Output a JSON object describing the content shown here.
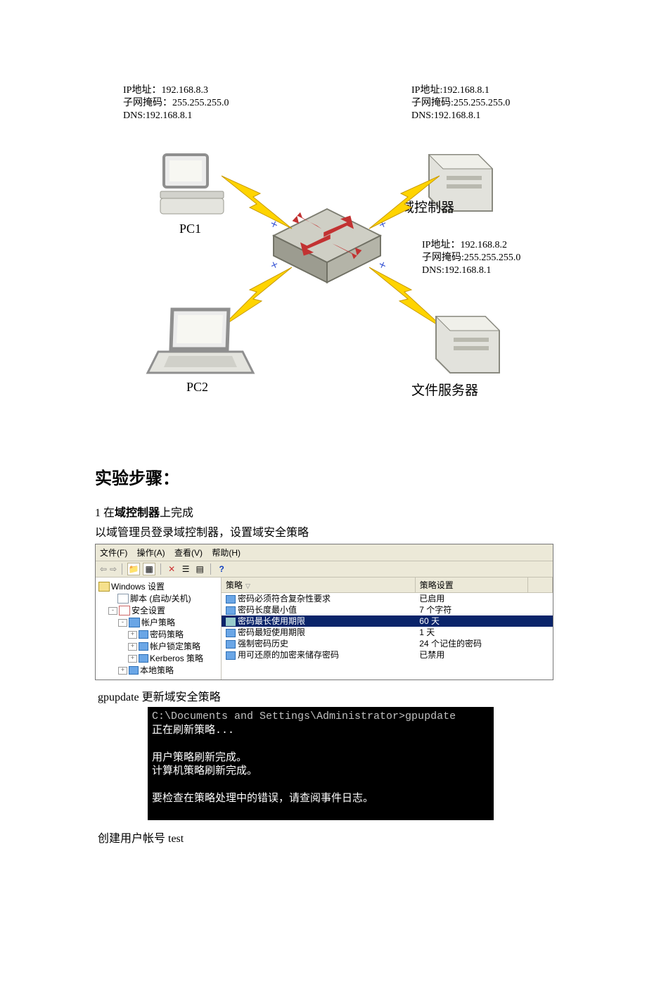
{
  "diagram": {
    "pc1": {
      "name": "PC1",
      "info": "IP地址：192.168.8.3\n子网掩码：255.255.255.0\nDNS:192.168.8.1"
    },
    "pc2": {
      "name": "PC2"
    },
    "dc": {
      "name": "域控制器",
      "info": "IP地址:192.168.8.1\n子网掩码:255.255.255.0\nDNS:192.168.8.1"
    },
    "fs": {
      "name": "文件服务器",
      "info": "IP地址：192.168.8.2\n子网掩码:255.255.255.0\nDNS:192.168.8.1"
    }
  },
  "section_title": "实验步骤：",
  "step1_prefix": "1 在",
  "step1_bold": "域控制器",
  "step1_suffix": "上完成",
  "step1_line2": "以域管理员登录域控制器，设置域安全策略",
  "mmc": {
    "menu": {
      "file": "文件(F)",
      "action": "操作(A)",
      "view": "查看(V)",
      "help": "帮助(H)"
    },
    "tree": {
      "root": "Windows 设置",
      "scripts": "脚本 (启动/关机)",
      "sec": "安全设置",
      "acct": "帐户策略",
      "pwd": "密码策略",
      "lock": "帐户锁定策略",
      "kerb": "Kerberos 策略",
      "local": "本地策略"
    },
    "cols": {
      "policy": "策略",
      "setting": "策略设置"
    },
    "rows": [
      {
        "p": "密码必须符合复杂性要求",
        "v": "已启用"
      },
      {
        "p": "密码长度最小值",
        "v": "7 个字符"
      },
      {
        "p": "密码最长使用期限",
        "v": "60 天",
        "sel": true
      },
      {
        "p": "密码最短使用期限",
        "v": "1 天"
      },
      {
        "p": "强制密码历史",
        "v": "24 个记住的密码"
      },
      {
        "p": "用可还原的加密来储存密码",
        "v": "已禁用"
      }
    ]
  },
  "gpupdate_caption": "gpupdate 更新域安全策略",
  "console": {
    "prompt": "C:\\Documents and Settings\\Administrator>gpupdate",
    "l1": "正在刷新策略...",
    "l2": "用户策略刷新完成。",
    "l3": "计算机策略刷新完成。",
    "l4": "要检查在策略处理中的错误，请查阅事件日志。"
  },
  "create_user": "创建用户帐号 test"
}
